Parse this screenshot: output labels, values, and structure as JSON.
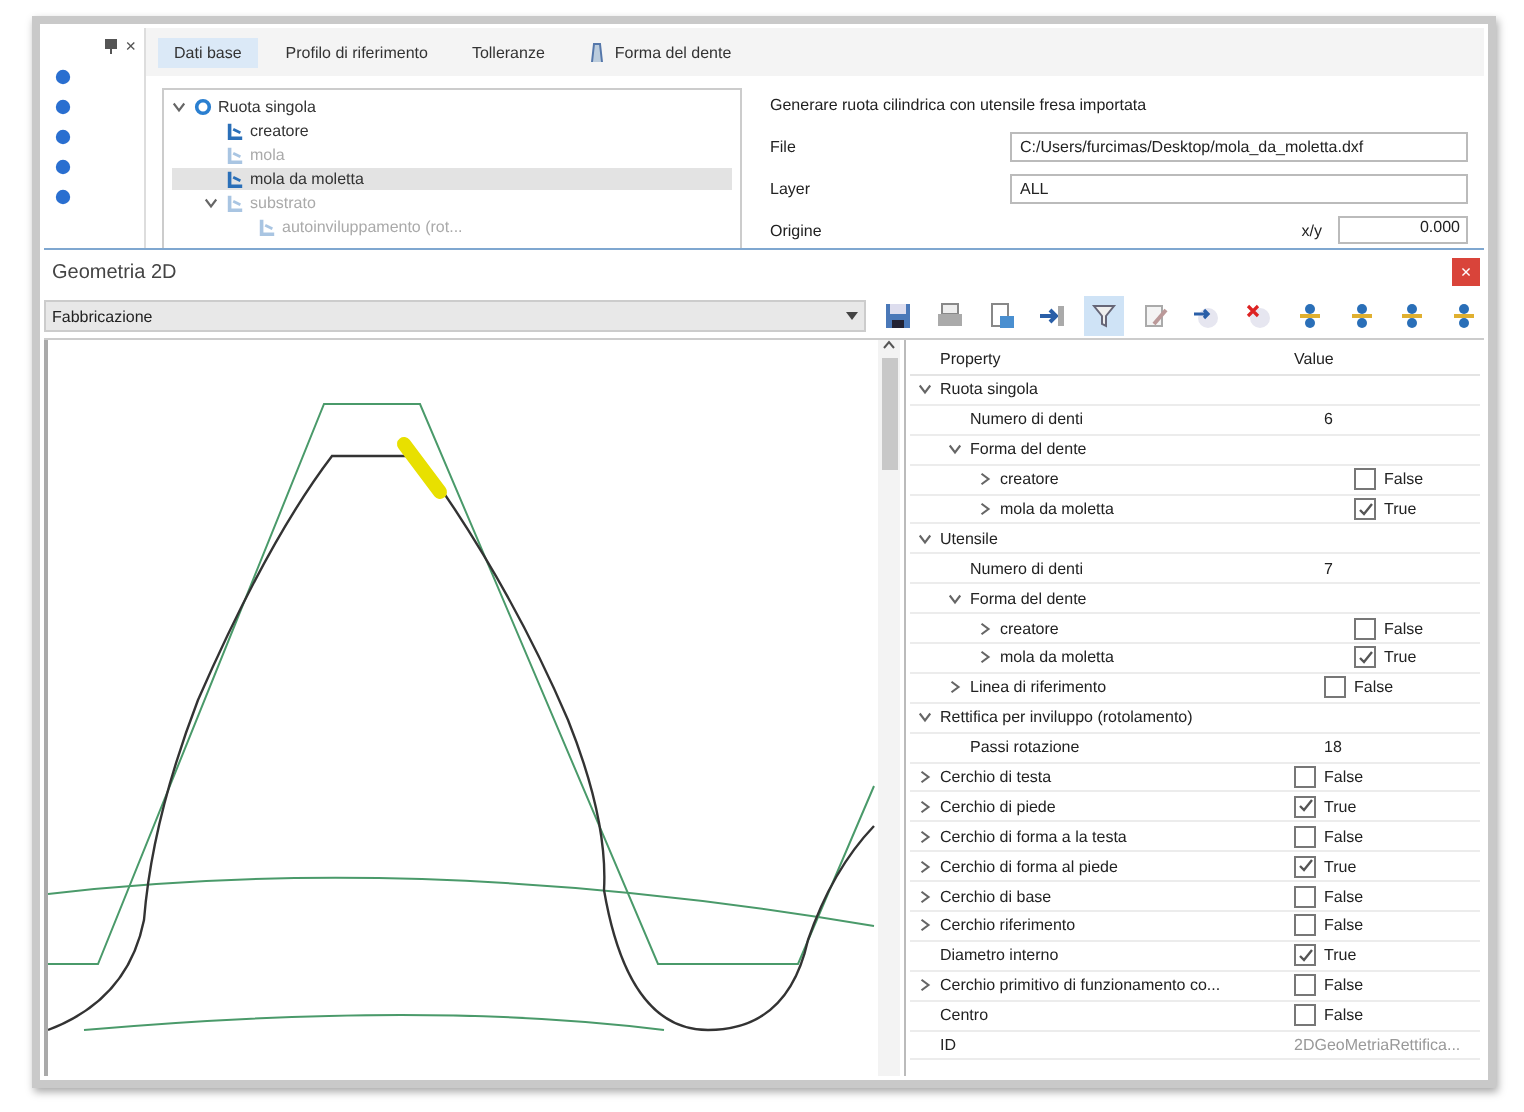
{
  "top_panel": {
    "close": "×",
    "tabs": [
      {
        "label": "Dati base",
        "selected": true,
        "kind": "plain"
      },
      {
        "label": "Profilo di riferimento",
        "selected": false,
        "kind": "plain"
      },
      {
        "label": "Tolleranze",
        "selected": false,
        "kind": "plain"
      },
      {
        "label": "Forma del dente",
        "selected": false,
        "kind": "icon"
      }
    ],
    "tree": [
      {
        "label": "Ruota singola",
        "kind": "wheel",
        "expanded": true,
        "selected": false,
        "disabled": false,
        "children": [
          {
            "label": "creatore",
            "kind": "tool",
            "selected": false,
            "disabled": false
          },
          {
            "label": "mola",
            "kind": "tool",
            "selected": false,
            "disabled": true
          },
          {
            "label": "mola da moletta",
            "kind": "tool",
            "selected": true,
            "disabled": false
          },
          {
            "label": "substrato",
            "kind": "tool",
            "expanded": true,
            "selected": false,
            "disabled": true,
            "children": [
              {
                "label": "autoinviluppamento (rot...",
                "kind": "tool",
                "selected": false,
                "disabled": true
              }
            ]
          }
        ]
      }
    ],
    "form": {
      "title": "Generare ruota cilindrica con utensile fresa importata",
      "fields": [
        {
          "label": "File",
          "value": "C:/Users/furcimas/Desktop/mola_da_moletta.dxf"
        },
        {
          "label": "Layer",
          "value": "ALL"
        }
      ],
      "origin": {
        "label": "Origine",
        "axis": "x/y",
        "value": "0.000"
      }
    }
  },
  "geometry": {
    "title": "Geometria 2D",
    "close": "×",
    "view_select": "Fabbricazione",
    "toolbar": [
      {
        "kind": "save",
        "selected": false
      },
      {
        "kind": "print",
        "selected": false
      },
      {
        "kind": "document",
        "selected": false
      },
      {
        "kind": "import",
        "selected": false
      },
      {
        "kind": "filter",
        "selected": true
      },
      {
        "kind": "edit",
        "selected": false
      },
      {
        "kind": "forward",
        "selected": false
      },
      {
        "kind": "delete",
        "selected": false
      },
      {
        "kind": "node",
        "selected": false
      },
      {
        "kind": "node",
        "selected": false
      },
      {
        "kind": "node",
        "selected": false
      },
      {
        "kind": "node",
        "selected": false
      }
    ],
    "properties": {
      "columns": [
        "Property",
        "Value"
      ],
      "rows": [
        {
          "label": "Ruota singola",
          "kind": "group",
          "expanded": true,
          "children": [
            {
              "label": "Numero di denti",
              "kind": "text",
              "value": "6"
            },
            {
              "label": "Forma del dente",
              "kind": "group",
              "expanded": true,
              "children": [
                {
                  "label": "creatore",
                  "kind": "bool",
                  "expanded": false,
                  "checked": false,
                  "value": "False"
                },
                {
                  "label": "mola da moletta",
                  "kind": "bool",
                  "expanded": false,
                  "checked": true,
                  "value": "True"
                }
              ]
            }
          ]
        },
        {
          "label": "Utensile",
          "kind": "group",
          "expanded": true,
          "children": [
            {
              "label": "Numero di denti",
              "kind": "text",
              "value": "7"
            },
            {
              "label": "Forma del dente",
              "kind": "group",
              "expanded": true,
              "children": [
                {
                  "label": "creatore",
                  "kind": "bool",
                  "expanded": false,
                  "checked": false,
                  "value": "False"
                },
                {
                  "label": "mola da moletta",
                  "kind": "bool",
                  "expanded": false,
                  "checked": true,
                  "value": "True"
                }
              ]
            },
            {
              "label": "Linea di riferimento",
              "kind": "bool",
              "expanded": false,
              "checked": false,
              "value": "False"
            }
          ]
        },
        {
          "label": "Rettifica per inviluppo (rotolamento)",
          "kind": "group",
          "expanded": true,
          "children": [
            {
              "label": "Passi rotazione",
              "kind": "text",
              "value": "18"
            }
          ]
        },
        {
          "label": "Cerchio di testa",
          "kind": "bool",
          "expanded": false,
          "checked": false,
          "value": "False"
        },
        {
          "label": "Cerchio di piede",
          "kind": "bool",
          "expanded": false,
          "checked": true,
          "value": "True"
        },
        {
          "label": "Cerchio di forma a la testa",
          "kind": "bool",
          "expanded": false,
          "checked": false,
          "value": "False"
        },
        {
          "label": "Cerchio di forma al piede",
          "kind": "bool",
          "expanded": false,
          "checked": true,
          "value": "True"
        },
        {
          "label": "Cerchio di base",
          "kind": "bool",
          "expanded": false,
          "checked": false,
          "value": "False"
        },
        {
          "label": "Cerchio riferimento",
          "kind": "bool",
          "expanded": false,
          "checked": false,
          "value": "False"
        },
        {
          "label": "Diametro interno",
          "kind": "bool",
          "checked": true,
          "value": "True"
        },
        {
          "label": "Cerchio primitivo di funzionamento co...",
          "kind": "bool",
          "expanded": false,
          "checked": false,
          "value": "False"
        },
        {
          "label": "Centro",
          "kind": "bool",
          "checked": false,
          "value": "False"
        },
        {
          "label": "ID",
          "kind": "readonly",
          "value": "2DGeoMetriaRettifica..."
        }
      ]
    }
  }
}
